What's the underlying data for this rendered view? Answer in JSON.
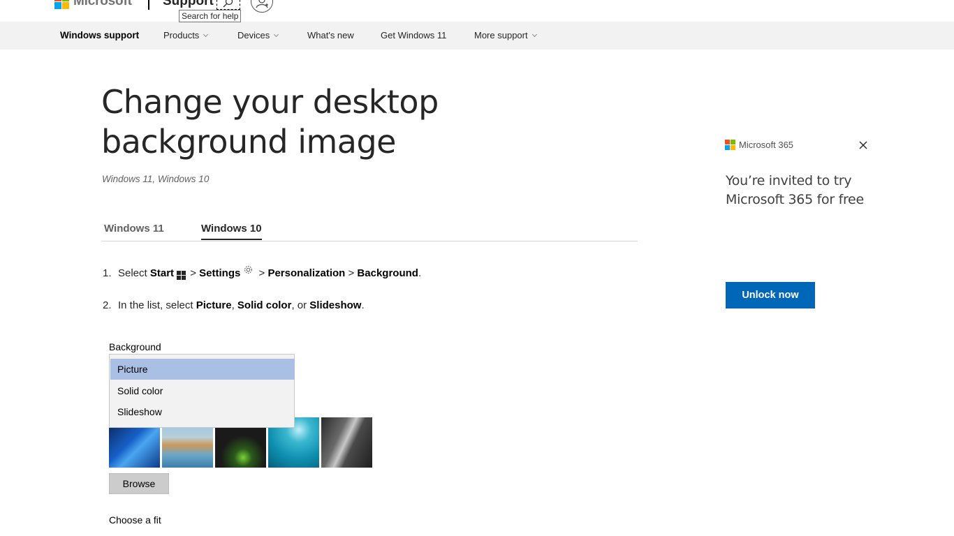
{
  "header": {
    "brand": "Microsoft",
    "section": "Support",
    "search_tooltip": "Search for help",
    "icons": {
      "search": "search-icon",
      "account": "account-icon",
      "logo": "microsoft-logo-icon"
    }
  },
  "nav": {
    "brand": "Windows support",
    "items": [
      {
        "label": "Products",
        "has_menu": true
      },
      {
        "label": "Devices",
        "has_menu": true
      },
      {
        "label": "What's new",
        "has_menu": false
      },
      {
        "label": "Get Windows 11",
        "has_menu": false
      },
      {
        "label": "More support",
        "has_menu": true
      }
    ]
  },
  "article": {
    "title": "Change your desktop background image",
    "applies_to": "Windows 11, Windows 10",
    "tabs": [
      {
        "label": "Windows 11",
        "active": false
      },
      {
        "label": "Windows 10",
        "active": true
      }
    ],
    "steps": {
      "s1": {
        "num": "1.",
        "pre": "Select ",
        "start": "Start",
        "sep1": " > ",
        "settings": "Settings",
        "sep2": " > ",
        "personalization": "Personalization",
        "sep3": " > ",
        "background": "Background",
        "end": "."
      },
      "s2": {
        "num": "2.",
        "pre": "In the list, select ",
        "picture": "Picture",
        "comma1": ", ",
        "solid": "Solid color",
        "or": ", or ",
        "slideshow": "Slideshow",
        "end": "."
      }
    },
    "settings_mock": {
      "background_label": "Background",
      "dropdown_options": [
        "Picture",
        "Solid color",
        "Slideshow"
      ],
      "selected_option": "Picture",
      "browse_label": "Browse",
      "fit_label": "Choose a fit"
    }
  },
  "promo": {
    "brand": "Microsoft 365",
    "text": "You’re invited to try Microsoft 365 for free",
    "button": "Unlock now",
    "accent": "#0067b8"
  },
  "colors": {
    "nav_bg": "#f2f2f2",
    "dropdown_selected": "#a9bfe3",
    "text": "#262626"
  }
}
